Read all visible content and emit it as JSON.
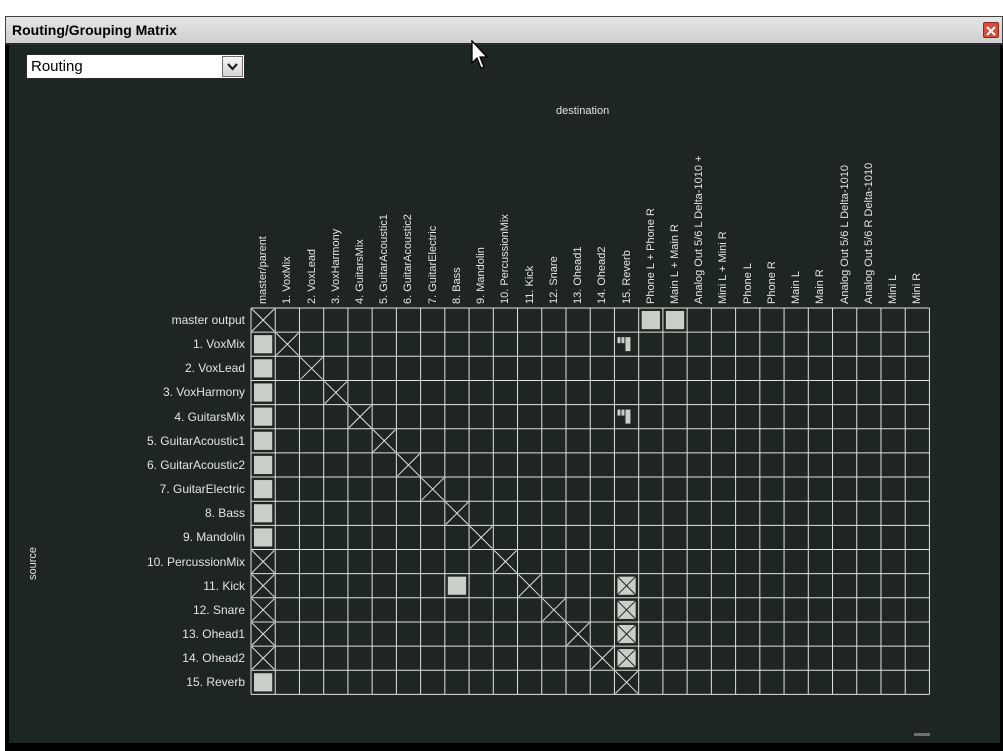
{
  "window": {
    "title": "Routing/Grouping Matrix"
  },
  "mode_select": {
    "value": "Routing"
  },
  "axis_labels": {
    "destination": "destination",
    "source": "source"
  },
  "columns": [
    "master/parent",
    "1. VoxMix",
    "2. VoxLead",
    "3. VoxHarmony",
    "4. GuitarsMix",
    "5. GuitarAcoustic1",
    "6. GuitarAcoustic2",
    "7. GuitarElectric",
    "8. Bass",
    "9. Mandolin",
    "10. PercussionMix",
    "11. Kick",
    "12. Snare",
    "13. Ohead1",
    "14. Ohead2",
    "15. Reverb",
    "Phone L + Phone R",
    "Main L + Main R",
    "Analog Out 5/6 L Delta-1010 +",
    "Mini L + Mini R",
    "Phone L",
    "Phone R",
    "Main L",
    "Main R",
    "Analog Out 5/6 L Delta-1010",
    "Analog Out 5/6 R Delta-1010",
    "Mini L",
    "Mini R"
  ],
  "rows": [
    "master output",
    "1. VoxMix",
    "2. VoxLead",
    "3. VoxHarmony",
    "4. GuitarsMix",
    "5. GuitarAcoustic1",
    "6. GuitarAcoustic2",
    "7. GuitarElectric",
    "8. Bass",
    "9. Mandolin",
    "10. PercussionMix",
    "11. Kick",
    "12. Snare",
    "13. Ohead1",
    "14. Ohead2",
    "15. Reverb"
  ],
  "cells": {
    "active": [
      [
        0,
        16
      ],
      [
        0,
        17
      ],
      [
        1,
        0
      ],
      [
        2,
        0
      ],
      [
        3,
        0
      ],
      [
        4,
        0
      ],
      [
        5,
        0
      ],
      [
        6,
        0
      ],
      [
        7,
        0
      ],
      [
        8,
        0
      ],
      [
        9,
        0
      ],
      [
        15,
        0
      ]
    ],
    "disabled": [
      [
        0,
        0
      ],
      [
        1,
        1
      ],
      [
        2,
        2
      ],
      [
        3,
        3
      ],
      [
        4,
        4
      ],
      [
        5,
        5
      ],
      [
        6,
        6
      ],
      [
        7,
        7
      ],
      [
        8,
        8
      ],
      [
        9,
        9
      ],
      [
        10,
        10
      ],
      [
        11,
        11
      ],
      [
        12,
        12
      ],
      [
        13,
        13
      ],
      [
        14,
        14
      ],
      [
        15,
        15
      ],
      [
        10,
        0
      ],
      [
        11,
        0
      ],
      [
        12,
        0
      ],
      [
        13,
        0
      ],
      [
        14,
        0
      ],
      [
        11,
        15
      ],
      [
        12,
        15
      ],
      [
        13,
        15
      ],
      [
        14,
        15
      ]
    ],
    "disabled_active": [
      [
        11,
        8
      ],
      [
        11,
        15
      ],
      [
        12,
        15
      ],
      [
        13,
        15
      ],
      [
        14,
        15
      ]
    ],
    "send_meter": [
      [
        1,
        15
      ],
      [
        4,
        15
      ]
    ]
  },
  "colors": {
    "background": "#1e2622",
    "grid_line": "#dfe4df",
    "cell_active": "#c9cfc9",
    "text": "#e2e6e2"
  }
}
